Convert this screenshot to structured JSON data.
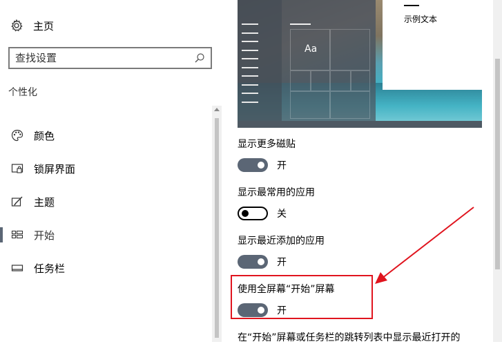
{
  "sidebar": {
    "home_label": "主页",
    "search_placeholder": "查找设置",
    "section_title": "个性化",
    "items": [
      {
        "label": "颜色",
        "icon": "palette-icon",
        "active": false
      },
      {
        "label": "锁屏界面",
        "icon": "lock-screen-icon",
        "active": false
      },
      {
        "label": "主题",
        "icon": "theme-brush-icon",
        "active": false
      },
      {
        "label": "开始",
        "icon": "start-tiles-icon",
        "active": true
      },
      {
        "label": "任务栏",
        "icon": "taskbar-icon",
        "active": false
      }
    ]
  },
  "preview": {
    "tile_text": "Aa",
    "sample_text": "示例文本"
  },
  "settings": [
    {
      "title": "显示更多磁贴",
      "state": "开",
      "on": true
    },
    {
      "title": "显示最常用的应用",
      "state": "关",
      "on": false
    },
    {
      "title": "显示最近添加的应用",
      "state": "开",
      "on": true
    },
    {
      "title": "使用全屏幕“开始”屏幕",
      "state": "开",
      "on": true
    },
    {
      "title": "在“开始”屏幕或任务栏的跳转列表中显示最近打开的",
      "state": "",
      "on": null
    }
  ],
  "colors": {
    "accent": "#5b6675",
    "annotation_red": "#e0141e"
  }
}
